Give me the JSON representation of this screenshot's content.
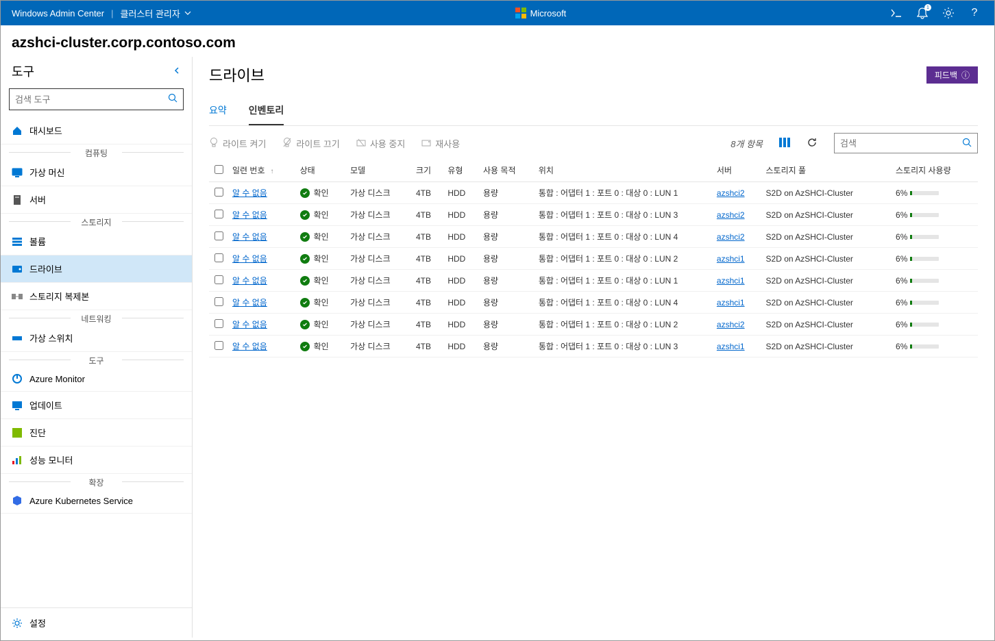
{
  "topbar": {
    "title": "Windows Admin Center",
    "context": "클러스터 관리자",
    "brand": "Microsoft",
    "notif_count": "1"
  },
  "cluster": {
    "name": "azshci-cluster.corp.contoso.com"
  },
  "sidebar": {
    "title": "도구",
    "search_placeholder": "검색 도구",
    "dashboard": "대시보드",
    "sections": {
      "compute": "컴퓨팅",
      "storage": "스토리지",
      "network": "네트워킹",
      "tools": "도구",
      "extensions": "확장"
    },
    "items": {
      "vms": "가상 머신",
      "servers": "서버",
      "volumes": "볼륨",
      "drives": "드라이브",
      "storage_replica": "스토리지 복제본",
      "vswitch": "가상 스위치",
      "azure_monitor": "Azure Monitor",
      "updates": "업데이트",
      "diagnostics": "진단",
      "perf_monitor": "성능 모니터",
      "aks": "Azure Kubernetes Service"
    },
    "settings": "설정"
  },
  "main": {
    "title": "드라이브",
    "feedback": "피드백",
    "tabs": {
      "summary": "요약",
      "inventory": "인벤토리"
    },
    "toolbar": {
      "light_on": "라이트 켜기",
      "light_off": "라이트 끄기",
      "retire": "사용 중지",
      "unretire": "재사용",
      "item_count": "8개 항목",
      "search_placeholder": "검색"
    },
    "columns": {
      "serial": "일련 번호",
      "status": "상태",
      "model": "모델",
      "size": "크기",
      "type": "유형",
      "used_for": "사용 목적",
      "location": "위치",
      "server": "서버",
      "pool": "스토리지 풀",
      "usage": "스토리지 사용량"
    },
    "rows": [
      {
        "serial": "알 수 없음",
        "status": "확인",
        "model": "가상 디스크",
        "size": "4TB",
        "type": "HDD",
        "used_for": "용량",
        "location": "통합 : 어댑터 1 : 포트 0 : 대상 0 : LUN 1",
        "server": "azshci2",
        "pool": "S2D on AzSHCI-Cluster",
        "usage": "6%"
      },
      {
        "serial": "알 수 없음",
        "status": "확인",
        "model": "가상 디스크",
        "size": "4TB",
        "type": "HDD",
        "used_for": "용량",
        "location": "통합 : 어댑터 1 : 포트 0 : 대상 0 : LUN 3",
        "server": "azshci2",
        "pool": "S2D on AzSHCI-Cluster",
        "usage": "6%"
      },
      {
        "serial": "알 수 없음",
        "status": "확인",
        "model": "가상 디스크",
        "size": "4TB",
        "type": "HDD",
        "used_for": "용량",
        "location": "통합 : 어댑터 1 : 포트 0 : 대상 0 : LUN 4",
        "server": "azshci2",
        "pool": "S2D on AzSHCI-Cluster",
        "usage": "6%"
      },
      {
        "serial": "알 수 없음",
        "status": "확인",
        "model": "가상 디스크",
        "size": "4TB",
        "type": "HDD",
        "used_for": "용량",
        "location": "통합 : 어댑터 1 : 포트 0 : 대상 0 : LUN 2",
        "server": "azshci1",
        "pool": "S2D on AzSHCI-Cluster",
        "usage": "6%"
      },
      {
        "serial": "알 수 없음",
        "status": "확인",
        "model": "가상 디스크",
        "size": "4TB",
        "type": "HDD",
        "used_for": "용량",
        "location": "통합 : 어댑터 1 : 포트 0 : 대상 0 : LUN 1",
        "server": "azshci1",
        "pool": "S2D on AzSHCI-Cluster",
        "usage": "6%"
      },
      {
        "serial": "알 수 없음",
        "status": "확인",
        "model": "가상 디스크",
        "size": "4TB",
        "type": "HDD",
        "used_for": "용량",
        "location": "통합 : 어댑터 1 : 포트 0 : 대상 0 : LUN 4",
        "server": "azshci1",
        "pool": "S2D on AzSHCI-Cluster",
        "usage": "6%"
      },
      {
        "serial": "알 수 없음",
        "status": "확인",
        "model": "가상 디스크",
        "size": "4TB",
        "type": "HDD",
        "used_for": "용량",
        "location": "통합 : 어댑터 1 : 포트 0 : 대상 0 : LUN 2",
        "server": "azshci2",
        "pool": "S2D on AzSHCI-Cluster",
        "usage": "6%"
      },
      {
        "serial": "알 수 없음",
        "status": "확인",
        "model": "가상 디스크",
        "size": "4TB",
        "type": "HDD",
        "used_for": "용량",
        "location": "통합 : 어댑터 1 : 포트 0 : 대상 0 : LUN 3",
        "server": "azshci1",
        "pool": "S2D on AzSHCI-Cluster",
        "usage": "6%"
      }
    ]
  }
}
